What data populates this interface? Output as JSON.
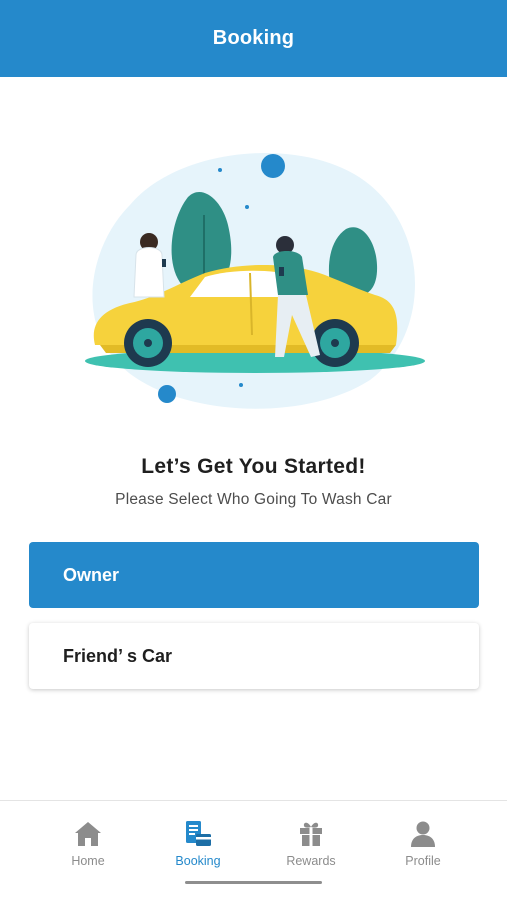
{
  "header": {
    "title": "Booking"
  },
  "main": {
    "heading": "Let’s Get You Started!",
    "subheading": "Please Select Who Going To Wash Car",
    "options": [
      {
        "label": "Owner",
        "selected": true
      },
      {
        "label": "Friend’ s Car",
        "selected": false
      }
    ]
  },
  "tabbar": {
    "tabs": [
      {
        "label": "Home",
        "icon": "home-icon",
        "active": false
      },
      {
        "label": "Booking",
        "icon": "booking-icon",
        "active": true
      },
      {
        "label": "Rewards",
        "icon": "gift-icon",
        "active": false
      },
      {
        "label": "Profile",
        "icon": "user-icon",
        "active": false
      }
    ]
  },
  "colors": {
    "primary": "#2589cb",
    "car": "#f6d23c",
    "tree": "#2f8f85",
    "inactive_tab": "#8c8c8c"
  }
}
